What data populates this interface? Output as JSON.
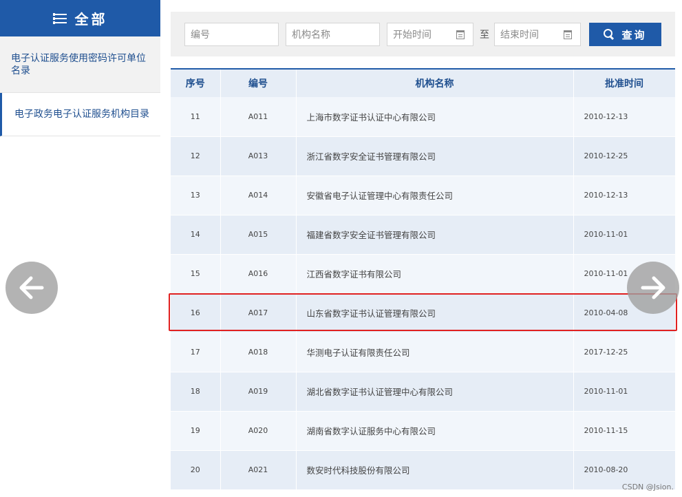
{
  "sidebar": {
    "title": "全部",
    "items": [
      {
        "label": "电子认证服务使用密码许可单位名录"
      },
      {
        "label": "电子政务电子认证服务机构目录"
      }
    ]
  },
  "filters": {
    "code_placeholder": "编号",
    "org_placeholder": "机构名称",
    "start_placeholder": "开始时间",
    "to_label": "至",
    "end_placeholder": "结束时间",
    "search_label": "查询"
  },
  "table": {
    "headers": {
      "index": "序号",
      "code": "编号",
      "name": "机构名称",
      "date": "批准时间"
    },
    "rows": [
      {
        "index": "11",
        "code": "A011",
        "name": "上海市数字证书认证中心有限公司",
        "date": "2010-12-13"
      },
      {
        "index": "12",
        "code": "A013",
        "name": "浙江省数字安全证书管理有限公司",
        "date": "2010-12-25"
      },
      {
        "index": "13",
        "code": "A014",
        "name": "安徽省电子认证管理中心有限责任公司",
        "date": "2010-12-13"
      },
      {
        "index": "14",
        "code": "A015",
        "name": "福建省数字安全证书管理有限公司",
        "date": "2010-11-01"
      },
      {
        "index": "15",
        "code": "A016",
        "name": "江西省数字证书有限公司",
        "date": "2010-11-01"
      },
      {
        "index": "16",
        "code": "A017",
        "name": "山东省数字证书认证管理有限公司",
        "date": "2010-04-08"
      },
      {
        "index": "17",
        "code": "A018",
        "name": "华测电子认证有限责任公司",
        "date": "2017-12-25"
      },
      {
        "index": "18",
        "code": "A019",
        "name": "湖北省数字证书认证管理中心有限公司",
        "date": "2010-11-01"
      },
      {
        "index": "19",
        "code": "A020",
        "name": "湖南省数字认证服务中心有限公司",
        "date": "2010-11-15"
      },
      {
        "index": "20",
        "code": "A021",
        "name": "数安时代科技股份有限公司",
        "date": "2010-08-20"
      }
    ]
  },
  "highlight_color": "#e02020",
  "accent_color": "#1f5aa8",
  "watermark": "CSDN @Jsion."
}
